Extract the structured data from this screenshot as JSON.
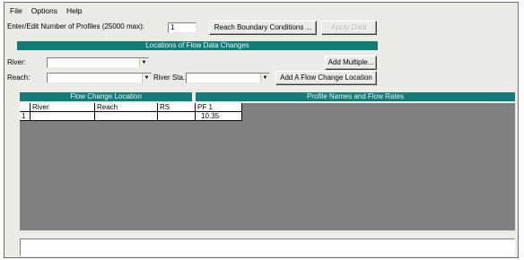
{
  "menu": [
    "File",
    "Options",
    "Help"
  ],
  "profiles": {
    "label": "Enter/Edit Number of Profiles (25000 max):",
    "value": "1",
    "reach_boundary_button": "Reach Boundary Conditions ...",
    "apply_data_button": "Apply Data"
  },
  "locations_section": {
    "title": "Locations of Flow Data Changes",
    "river_label": "River:",
    "river_value": "",
    "reach_label": "Reach:",
    "reach_value": "",
    "river_sta_label": "River Sta.:",
    "river_sta_value": "",
    "add_multiple_button": "Add Multiple...",
    "add_location_button": "Add A Flow Change Location"
  },
  "flow_change_header": "Flow Change Location",
  "profile_header": "Profile Names and Flow Rates",
  "table": {
    "columns": [
      "River",
      "Reach",
      "RS",
      "PF 1"
    ],
    "rows": [
      {
        "index": "1",
        "river": "",
        "reach": "",
        "rs": "",
        "pf1": "10.35"
      }
    ]
  },
  "status_text": ""
}
